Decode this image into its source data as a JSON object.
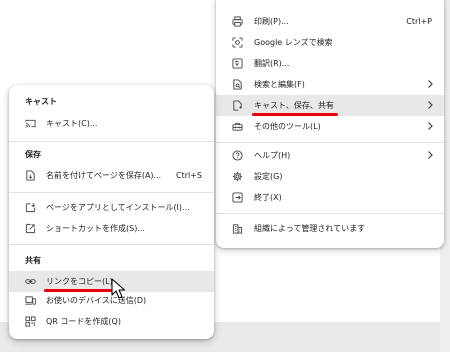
{
  "main_menu": {
    "print": {
      "label": "印刷(P)...",
      "shortcut": "Ctrl+P"
    },
    "lens": {
      "label": "Google レンズで検索"
    },
    "translate": {
      "label": "翻訳(R)..."
    },
    "find_edit": {
      "label": "検索と編集(F)"
    },
    "cast_save_share": {
      "label": "キャスト、保存、共有"
    },
    "more_tools": {
      "label": "その他のツール(L)"
    },
    "help": {
      "label": "ヘルプ(H)"
    },
    "settings": {
      "label": "設定(G)"
    },
    "exit": {
      "label": "終了(X)"
    },
    "managed": {
      "label": "組織によって管理されています"
    }
  },
  "sub_menu": {
    "cast_header": "キャスト",
    "cast": {
      "label": "キャスト(C)..."
    },
    "save_header": "保存",
    "save_page": {
      "label": "名前を付けてページを保存(A)...",
      "shortcut": "Ctrl+S"
    },
    "install_app": {
      "label": "ページをアプリとしてインストール(I)..."
    },
    "create_shortcut": {
      "label": "ショートカットを作成(S)..."
    },
    "share_header": "共有",
    "copy_link": {
      "label": "リンクをコピー(L)"
    },
    "send_devices": {
      "label": "お使いのデバイスに送信(D)"
    },
    "qr_code": {
      "label": "QR コードを作成(Q)"
    }
  },
  "accent_color": "#e60012"
}
